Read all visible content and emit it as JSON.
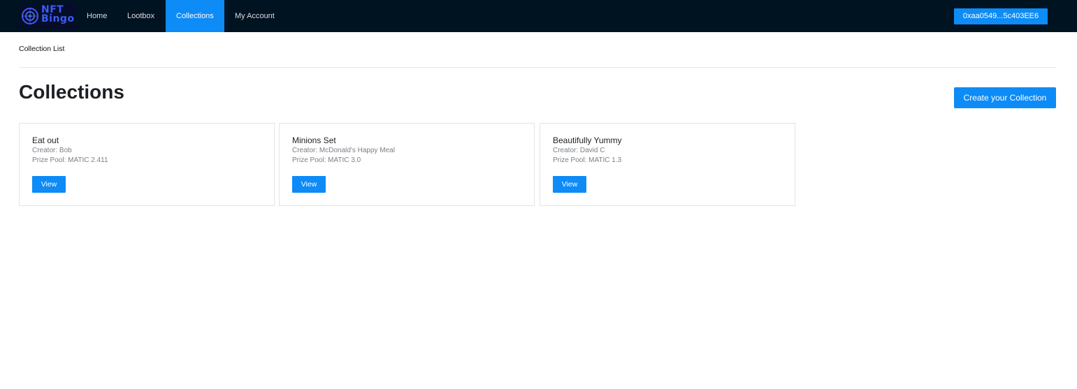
{
  "navbar": {
    "logo": {
      "line1": "NFT",
      "line2": "Bingo"
    },
    "items": [
      {
        "label": "Home",
        "active": false
      },
      {
        "label": "Lootbox",
        "active": false
      },
      {
        "label": "Collections",
        "active": true
      },
      {
        "label": "My Account",
        "active": false
      }
    ],
    "wallet_label": "0xaa0549...5c403EE6"
  },
  "breadcrumb": "Collection List",
  "page": {
    "title": "Collections",
    "create_label": "Create your Collection"
  },
  "collections": [
    {
      "name": "Eat out",
      "creator": "Creator: Bob",
      "prize_pool": "Prize Pool: MATIC 2.411",
      "view_label": "View"
    },
    {
      "name": "Minions Set",
      "creator": "Creator: McDonald's Happy Meal",
      "prize_pool": "Prize Pool: MATIC 3.0",
      "view_label": "View"
    },
    {
      "name": "Beautifully Yummy",
      "creator": "Creator: David C",
      "prize_pool": "Prize Pool: MATIC 1.3",
      "view_label": "View"
    }
  ],
  "colors": {
    "navbar_bg": "#001320",
    "accent": "#0d8bf7",
    "logo_bg": "#050d2a",
    "logo_text": "#3a5df0"
  }
}
